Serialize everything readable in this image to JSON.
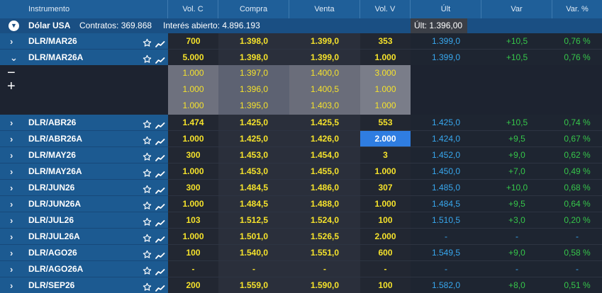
{
  "header": {
    "instrumento": "Instrumento",
    "vol_c": "Vol. C",
    "compra": "Compra",
    "venta": "Venta",
    "vol_v": "Vol. V",
    "ult": "Últ",
    "var": "Var",
    "var_pct": "Var. %"
  },
  "group": {
    "title": "Dólar USA",
    "contratos": "Contratos: 369.868",
    "interes": "Interés abierto: 4.896.193",
    "ult": "Últ: 1.396,00"
  },
  "book": {
    "rows": [
      {
        "vol_c": "1.000",
        "compra": "1.397,0",
        "venta": "1.400,0",
        "vol_v": "3.000"
      },
      {
        "vol_c": "1.000",
        "compra": "1.396,0",
        "venta": "1.400,5",
        "vol_v": "1.000"
      },
      {
        "vol_c": "1.000",
        "compra": "1.395,0",
        "venta": "1.403,0",
        "vol_v": "1.000"
      }
    ]
  },
  "rows": [
    {
      "name": "DLR/MAR26",
      "chev": "›",
      "vol_c": "700",
      "compra": "1.398,0",
      "venta": "1.399,0",
      "vol_v": "353",
      "ult": "1.399,0",
      "var": "+10,5",
      "var_pct": "0,76 %"
    },
    {
      "name": "DLR/MAR26A",
      "chev": "⌄",
      "vol_c": "5.000",
      "compra": "1.398,0",
      "venta": "1.399,0",
      "vol_v": "1.000",
      "ult": "1.399,0",
      "var": "+10,5",
      "var_pct": "0,76 %"
    },
    {
      "name": "DLR/ABR26",
      "chev": "›",
      "vol_c": "1.474",
      "compra": "1.425,0",
      "venta": "1.425,5",
      "vol_v": "553",
      "ult": "1.425,0",
      "var": "+10,5",
      "var_pct": "0,74 %"
    },
    {
      "name": "DLR/ABR26A",
      "chev": "›",
      "vol_c": "1.000",
      "compra": "1.425,0",
      "venta": "1.426,0",
      "vol_v": "2.000",
      "ult": "1.424,0",
      "var": "+9,5",
      "var_pct": "0,67 %"
    },
    {
      "name": "DLR/MAY26",
      "chev": "›",
      "vol_c": "300",
      "compra": "1.453,0",
      "venta": "1.454,0",
      "vol_v": "3",
      "ult": "1.452,0",
      "var": "+9,0",
      "var_pct": "0,62 %"
    },
    {
      "name": "DLR/MAY26A",
      "chev": "›",
      "vol_c": "1.000",
      "compra": "1.453,0",
      "venta": "1.455,0",
      "vol_v": "1.000",
      "ult": "1.450,0",
      "var": "+7,0",
      "var_pct": "0,49 %"
    },
    {
      "name": "DLR/JUN26",
      "chev": "›",
      "vol_c": "300",
      "compra": "1.484,5",
      "venta": "1.486,0",
      "vol_v": "307",
      "ult": "1.485,0",
      "var": "+10,0",
      "var_pct": "0,68 %"
    },
    {
      "name": "DLR/JUN26A",
      "chev": "›",
      "vol_c": "1.000",
      "compra": "1.484,5",
      "venta": "1.488,0",
      "vol_v": "1.000",
      "ult": "1.484,5",
      "var": "+9,5",
      "var_pct": "0,64 %"
    },
    {
      "name": "DLR/JUL26",
      "chev": "›",
      "vol_c": "103",
      "compra": "1.512,5",
      "venta": "1.524,0",
      "vol_v": "100",
      "ult": "1.510,5",
      "var": "+3,0",
      "var_pct": "0,20 %"
    },
    {
      "name": "DLR/JUL26A",
      "chev": "›",
      "vol_c": "1.000",
      "compra": "1.501,0",
      "venta": "1.526,5",
      "vol_v": "2.000",
      "ult": "-",
      "var": "-",
      "var_pct": "-"
    },
    {
      "name": "DLR/AGO26",
      "chev": "›",
      "vol_c": "100",
      "compra": "1.540,0",
      "venta": "1.551,0",
      "vol_v": "600",
      "ult": "1.549,5",
      "var": "+9,0",
      "var_pct": "0,58 %"
    },
    {
      "name": "DLR/AGO26A",
      "chev": "›",
      "vol_c": "-",
      "compra": "-",
      "venta": "-",
      "vol_v": "-",
      "ult": "-",
      "var": "-",
      "var_pct": "-"
    },
    {
      "name": "DLR/SEP26",
      "chev": "›",
      "vol_c": "200",
      "compra": "1.559,0",
      "venta": "1.590,0",
      "vol_v": "100",
      "ult": "1.582,0",
      "var": "+8,0",
      "var_pct": "0,51 %"
    }
  ],
  "colors": {
    "header_bg": "#1f5f99",
    "instrument_bg": "#1c5a91",
    "bid_ask_text": "#f5e22b",
    "last_text": "#38a8ef",
    "var_positive": "#36c64a",
    "selected_cell": "#2f7de1"
  },
  "icons": [
    "chevron-right-icon",
    "chevron-down-icon",
    "star-icon",
    "chart-icon",
    "minus-icon",
    "plus-icon"
  ]
}
